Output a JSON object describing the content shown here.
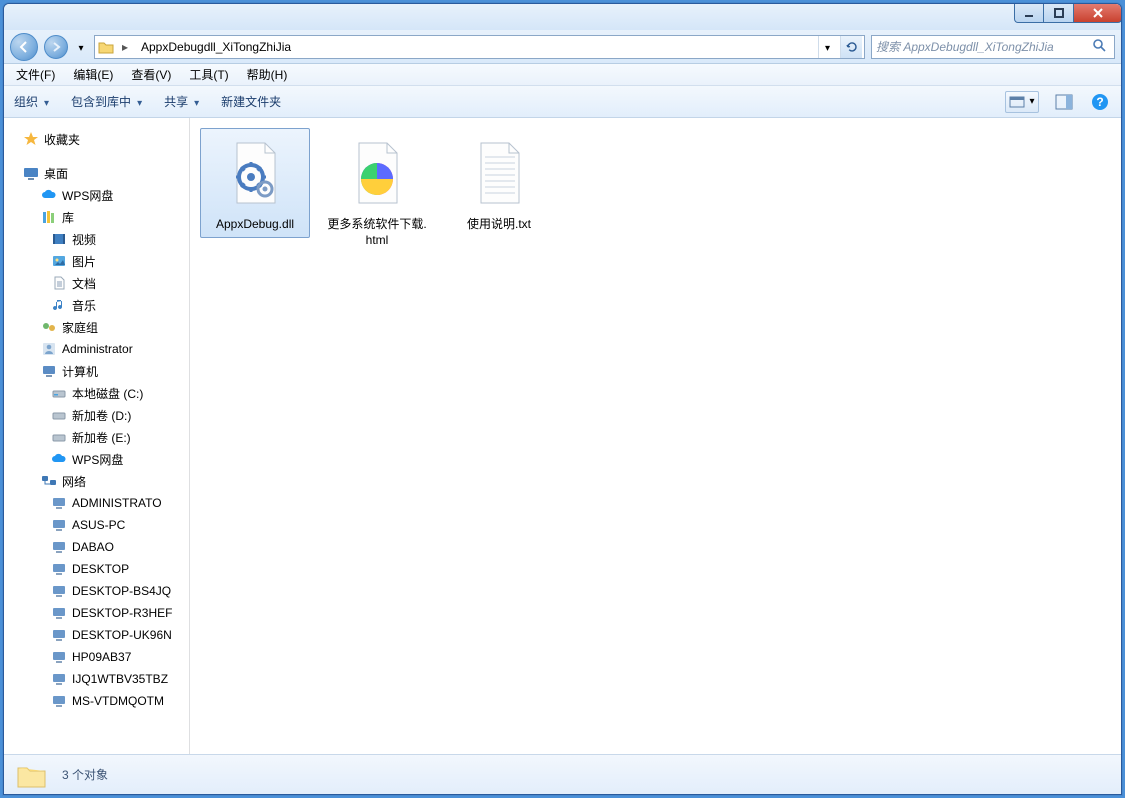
{
  "address": {
    "folder_name": "AppxDebugdll_XiTongZhiJia"
  },
  "search": {
    "placeholder": "搜索 AppxDebugdll_XiTongZhiJia"
  },
  "menu": {
    "file": "文件(F)",
    "edit": "编辑(E)",
    "view": "查看(V)",
    "tools": "工具(T)",
    "help": "帮助(H)"
  },
  "toolbar": {
    "organize": "组织",
    "include_in_library": "包含到库中",
    "share": "共享",
    "new_folder": "新建文件夹"
  },
  "tree": {
    "favorites": "收藏夹",
    "desktop": "桌面",
    "wps": "WPS网盘",
    "libraries": "库",
    "videos": "视频",
    "pictures": "图片",
    "documents": "文档",
    "music": "音乐",
    "homegroup": "家庭组",
    "administrator": "Administrator",
    "computer": "计算机",
    "drive_c": "本地磁盘 (C:)",
    "drive_d": "新加卷 (D:)",
    "drive_e": "新加卷 (E:)",
    "wps2": "WPS网盘",
    "network": "网络",
    "net_items": [
      "ADMINISTRATO",
      "ASUS-PC",
      "DABAO",
      "DESKTOP",
      "DESKTOP-BS4JQ",
      "DESKTOP-R3HEF",
      "DESKTOP-UK96N",
      "HP09AB37",
      "IJQ1WTBV35TBZ",
      "MS-VTDMQOTM"
    ]
  },
  "files": {
    "items": [
      {
        "name": "AppxDebug.dll",
        "type": "dll",
        "selected": true
      },
      {
        "name": "更多系统软件下载.html",
        "type": "html",
        "selected": false
      },
      {
        "name": "使用说明.txt",
        "type": "txt",
        "selected": false
      }
    ]
  },
  "status": {
    "text": "3 个对象"
  }
}
